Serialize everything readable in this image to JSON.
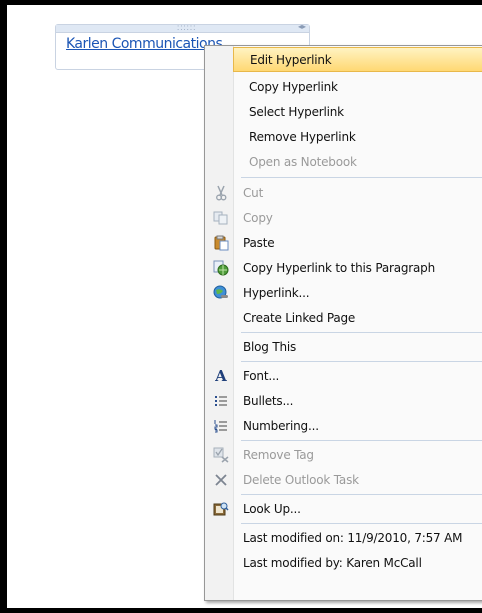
{
  "note": {
    "link_text": "Karlen Communications"
  },
  "menu": {
    "items": [
      {
        "label": "Edit Hyperlink",
        "icon": "",
        "disabled": false
      },
      {
        "label": "Copy Hyperlink",
        "icon": "",
        "disabled": false
      },
      {
        "label": "Select Hyperlink",
        "icon": "",
        "disabled": false
      },
      {
        "label": "Remove Hyperlink",
        "icon": "",
        "disabled": false
      },
      {
        "label": "Open as Notebook",
        "icon": "",
        "disabled": true
      },
      {
        "label": "Cut",
        "icon": "scissors-icon",
        "disabled": true
      },
      {
        "label": "Copy",
        "icon": "copy-icon",
        "disabled": true
      },
      {
        "label": "Paste",
        "icon": "clipboard-icon",
        "disabled": false
      },
      {
        "label": "Copy Hyperlink to this Paragraph",
        "icon": "link-globe-icon",
        "disabled": false
      },
      {
        "label": "Hyperlink...",
        "icon": "hyperlink-globe-icon",
        "disabled": false
      },
      {
        "label": "Create Linked Page",
        "icon": "",
        "disabled": false
      },
      {
        "label": "Blog This",
        "icon": "",
        "disabled": false
      },
      {
        "label": "Font...",
        "icon": "font-icon",
        "disabled": false
      },
      {
        "label": "Bullets...",
        "icon": "bullets-icon",
        "disabled": false
      },
      {
        "label": "Numbering...",
        "icon": "numbering-icon",
        "disabled": false
      },
      {
        "label": "Remove Tag",
        "icon": "remove-tag-icon",
        "disabled": true
      },
      {
        "label": "Delete Outlook Task",
        "icon": "delete-x-icon",
        "disabled": true
      },
      {
        "label": "Look Up...",
        "icon": "lookup-book-icon",
        "disabled": false
      },
      {
        "label": "Last modified on: 11/9/2010, 7:57 AM",
        "icon": "",
        "disabled": false
      },
      {
        "label": "Last modified by: Karen McCall",
        "icon": "",
        "disabled": false
      }
    ]
  },
  "colors": {
    "link": "#1b55b5",
    "highlight": "#ffd873",
    "disabled_text": "#9a9a9a"
  }
}
